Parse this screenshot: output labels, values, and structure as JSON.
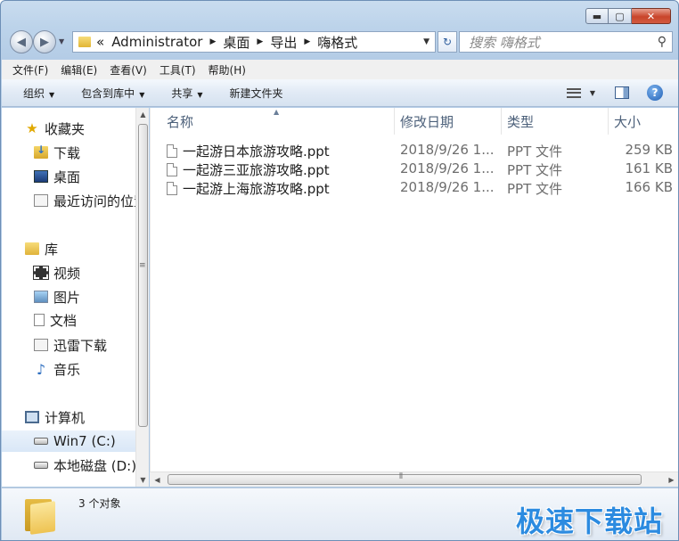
{
  "window": {
    "controls": {
      "minimize": "▬",
      "maximize": "▢",
      "close": "✕"
    }
  },
  "nav": {
    "back_glyph": "◀",
    "forward_glyph": "▶",
    "breadcrumb_prefix": "«",
    "breadcrumb": [
      "Administrator",
      "桌面",
      "导出",
      "嗨格式"
    ],
    "refresh_glyph": "↻",
    "search_placeholder": "搜索 嗨格式"
  },
  "menubar": [
    "文件(F)",
    "编辑(E)",
    "查看(V)",
    "工具(T)",
    "帮助(H)"
  ],
  "toolbar": {
    "organize": "组织",
    "include_in_library": "包含到库中",
    "share": "共享",
    "new_folder": "新建文件夹"
  },
  "sidebar": {
    "favorites": {
      "label": "收藏夹",
      "items": [
        "下载",
        "桌面",
        "最近访问的位置"
      ]
    },
    "libraries": {
      "label": "库",
      "items": [
        "视频",
        "图片",
        "文档",
        "迅雷下载",
        "音乐"
      ]
    },
    "computer": {
      "label": "计算机",
      "items": [
        "Win7 (C:)",
        "本地磁盘 (D:)"
      ]
    }
  },
  "columns": {
    "name": "名称",
    "modified": "修改日期",
    "type": "类型",
    "size": "大小"
  },
  "files": [
    {
      "name": "一起游日本旅游攻略.ppt",
      "modified": "2018/9/26 1...",
      "type": "PPT 文件",
      "size": "259 KB"
    },
    {
      "name": "一起游三亚旅游攻略.ppt",
      "modified": "2018/9/26 1...",
      "type": "PPT 文件",
      "size": "161 KB"
    },
    {
      "name": "一起游上海旅游攻略.ppt",
      "modified": "2018/9/26 1...",
      "type": "PPT 文件",
      "size": "166 KB"
    }
  ],
  "status": {
    "object_count": "3 个对象"
  },
  "watermark": "极速下载站",
  "colors": {
    "accent": "#2c8be0",
    "chrome": "#bcd3ea",
    "header_text": "#4c607a"
  }
}
